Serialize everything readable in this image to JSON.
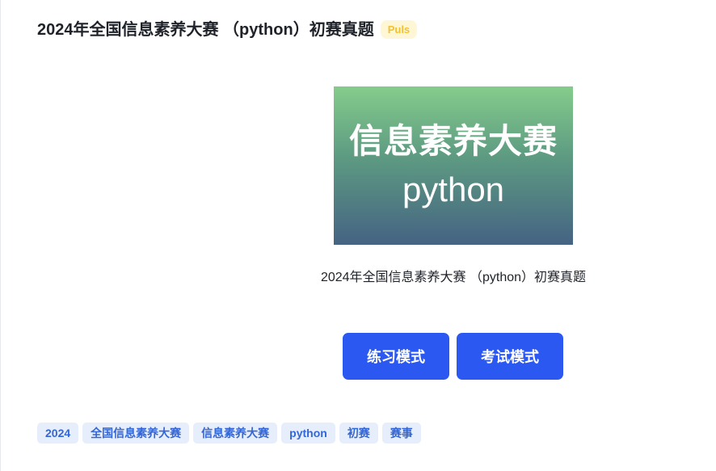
{
  "header": {
    "title": "2024年全国信息素养大赛 （python）初赛真题",
    "badge": "Puls"
  },
  "cover": {
    "line1": "信息素养大赛",
    "line2": "python",
    "gradient_top": "#85cc8b",
    "gradient_bottom": "#456383"
  },
  "caption": "2024年全国信息素养大赛 （python）初赛真题",
  "actions": {
    "practice_label": "练习模式",
    "exam_label": "考试模式",
    "button_color": "#2b58f0"
  },
  "tags": [
    "2024",
    "全国信息素养大赛",
    "信息素养大赛",
    "python",
    "初赛",
    "赛事"
  ]
}
